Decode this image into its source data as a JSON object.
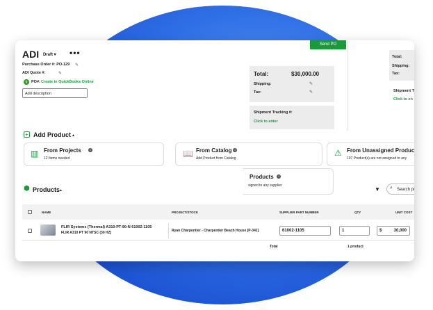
{
  "header": {
    "title": "ADI",
    "status": "Draft ▾",
    "more": "•••",
    "purchase_order": "Purchase Order #: PO-129",
    "adi_quote": "ADI Quote #:",
    "po_prefix": "PO#:",
    "po_link": "Create in QuickBooks Online",
    "description_placeholder": "Add description",
    "send_label": "Send PO"
  },
  "totals": {
    "total_label": "Total:",
    "total_value": "$30,000.00",
    "shipping_label": "Shipping:",
    "tax_label": "Tax:",
    "shipment_label": "Shipment Tracking #:",
    "shipment_link": "Click to enter"
  },
  "totals_right": {
    "total_label": "Total:",
    "shipping_label": "Shipping:",
    "tax_label": "Tax:",
    "shipment_label": "Shipment T",
    "shipment_link": "Click to en"
  },
  "add_product": {
    "title": "Add Product",
    "tiles": [
      {
        "title": "From Projects",
        "subtitle": "12 Items needed"
      },
      {
        "title": "From Catalog",
        "subtitle": "Add Product from Catalog"
      },
      {
        "title": "From Unassigned Products",
        "subtitle": "107 Product(s) are not assigned to any"
      }
    ],
    "overlay": {
      "title": "Products",
      "subtitle": "signed to any supplier"
    }
  },
  "products": {
    "title": "Products",
    "search_placeholder": "Search pro",
    "columns": [
      "NAME",
      "PROJECT/STOCK",
      "SUPPLIER PART NUMBER",
      "QTY",
      "UNIT COST"
    ],
    "rows": [
      {
        "name": "FLIR Systems (Thermal) A310-PT-90-N 61002-1105",
        "subname": "FLIR A310 PT 90 NTSC (30 HZ)",
        "project": "Ryan Charpentier - Charpentier Beach House [P-341]",
        "part": "61002-1105",
        "qty": "1",
        "currency": "$",
        "cost": "30,000"
      }
    ],
    "footer_total": "Total",
    "footer_count": "1 product"
  }
}
